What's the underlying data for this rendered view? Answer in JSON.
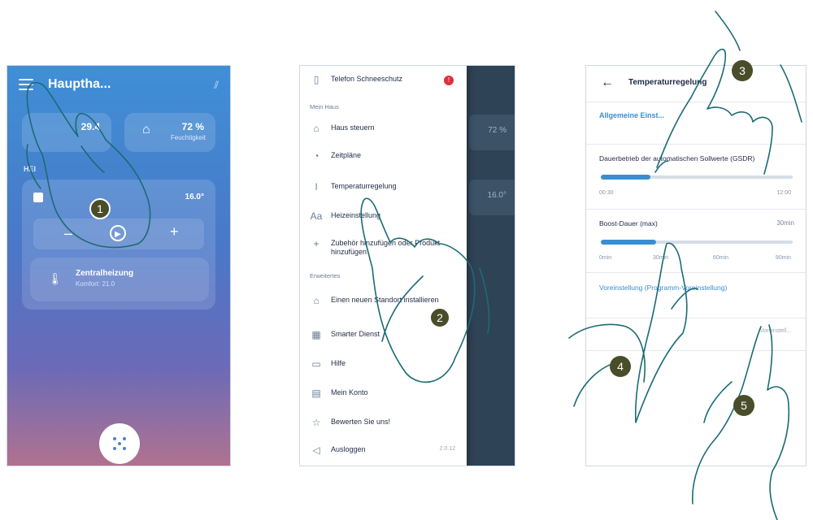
{
  "phone1": {
    "title": "Hauptha...",
    "temp_value": "29.4",
    "humidity_value": "72 %",
    "humidity_label": "Feuchtigkeit",
    "section_label": "HEI",
    "thermostat_label": "",
    "thermostat_value": "16.0°",
    "minus": "–",
    "plus": "+",
    "boiler_name": "Zentralheizung",
    "boiler_sub": "Komfort: 21.0"
  },
  "phone2": {
    "items": [
      {
        "icon": "phone-icon",
        "label": "Telefon Schneeschutz",
        "badge": "!"
      },
      {
        "section": "Mein Haus"
      },
      {
        "icon": "home-icon",
        "label": "Haus steuern"
      },
      {
        "icon": "clock-icon",
        "label": "Zeitpläne"
      },
      {
        "icon": "thermometer-icon",
        "label": "Temperaturregelung"
      },
      {
        "icon": "text-icon",
        "label": "Heizeinstellung"
      },
      {
        "icon": "plus-icon",
        "label": "Zubehör hinzufügen oder Produkt hinzufügen"
      },
      {
        "section": "Erweitertes"
      },
      {
        "icon": "house-add-icon",
        "label": "Einen neuen Standort installieren"
      },
      {
        "icon": "grid-icon",
        "label": "Smarter Dienst"
      },
      {
        "icon": "help-icon",
        "label": "Hilfe"
      },
      {
        "icon": "account-icon",
        "label": "Mein Konto"
      },
      {
        "icon": "star-icon",
        "label": "Bewerten Sie uns!"
      },
      {
        "icon": "logout-icon",
        "label": "Ausloggen",
        "version": "2.0.12"
      }
    ],
    "bg_values": [
      "72 %",
      "16.0°"
    ]
  },
  "phone3": {
    "title": "Temperaturregelung",
    "section_general": "Allgemeine Einst...",
    "row1_label": "Dauerbetrieb der automatischen Sollwerte (GSDR)",
    "row1_slider_fraction": 0.26,
    "row1_tick_left": "00:30",
    "row1_tick_right": "12:00",
    "row2_label": "Boost-Dauer (max)",
    "row2_value": "30min",
    "row2_slider_fraction": 0.29,
    "row2_ticks": [
      "0min",
      "30min",
      "60min",
      "90min"
    ],
    "link_text": "Voreinstellung (Programm-Voreinstellung)",
    "small_text": "Voreinstell..."
  },
  "callouts": [
    "1",
    "2",
    "3",
    "4",
    "5"
  ],
  "colors": {
    "accent": "#3a8dd0",
    "callout": "#4a4d2a",
    "badge": "#e0303a"
  }
}
